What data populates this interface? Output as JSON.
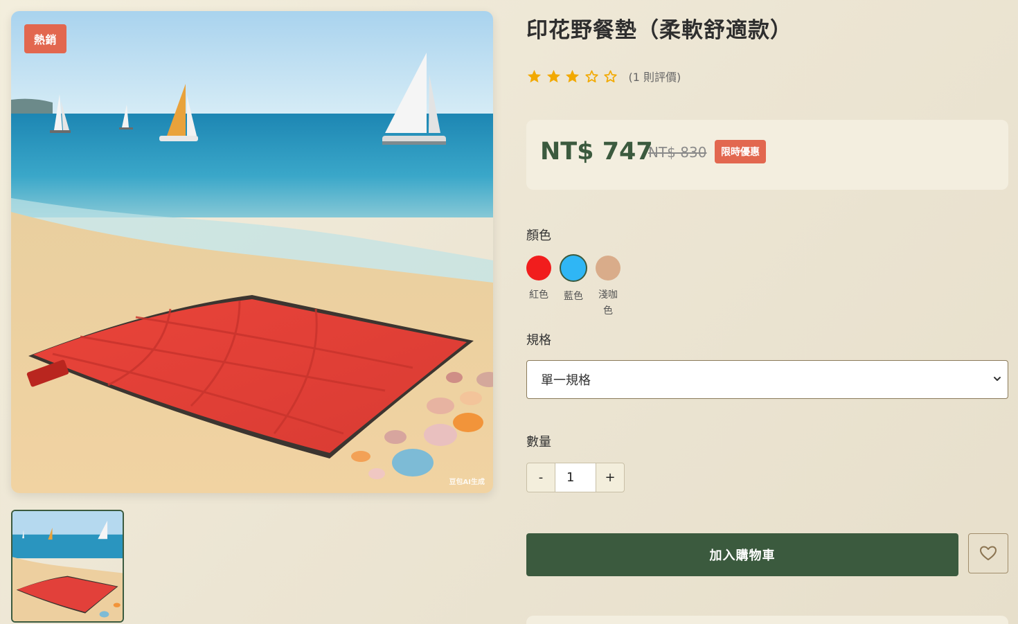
{
  "gallery": {
    "badge": "熱銷",
    "watermark": "豆包AI生成"
  },
  "product": {
    "title": "印花野餐墊（柔軟舒適款）",
    "rating": {
      "value": 3,
      "max": 5,
      "review_text": "(1 則評價)"
    },
    "price": {
      "current": "NT$ 747",
      "original": "NT$ 830",
      "promo_badge": "限時優惠"
    }
  },
  "options": {
    "color_label": "顏色",
    "colors": [
      {
        "name": "紅色",
        "hex": "#f11d1d",
        "selected": false
      },
      {
        "name": "藍色",
        "hex": "#2fb6f5",
        "selected": true
      },
      {
        "name": "淺咖色",
        "hex": "#d9ac8a",
        "selected": false
      }
    ],
    "spec_label": "規格",
    "spec_selected": "單一規格",
    "quantity_label": "數量",
    "quantity_value": "1",
    "minus_label": "-",
    "plus_label": "+"
  },
  "actions": {
    "add_to_cart": "加入購物車"
  },
  "theme": {
    "primary": "#3b5a3e",
    "accent": "#e2674f",
    "star": "#f2a900"
  },
  "icons": {
    "star_filled": "star-icon",
    "star_empty": "star-outline-icon",
    "heart": "heart-icon",
    "chevron": "chevron-down-icon"
  }
}
